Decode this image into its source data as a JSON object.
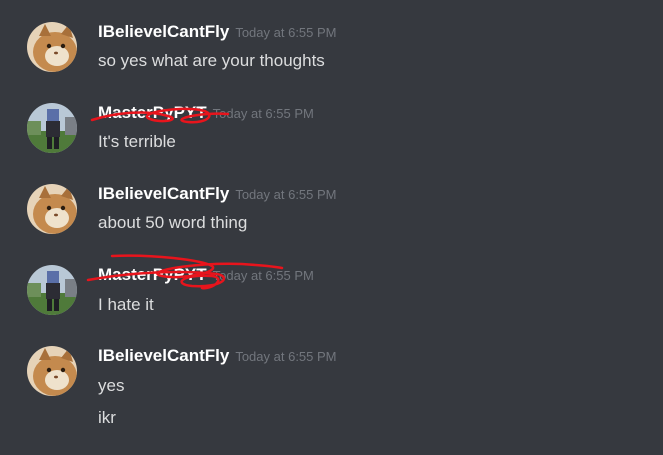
{
  "colors": {
    "background": "#36393f",
    "username": "#ffffff",
    "timestamp": "#72767d",
    "message_text": "#dcddde",
    "redaction_scribble": "#e8141c"
  },
  "messages": [
    {
      "username": "IBelievelCantFly",
      "timestamp": "Today at 6:55 PM",
      "avatar": "cat-avatar",
      "lines": [
        "so yes what are your thoughts"
      ]
    },
    {
      "username": "MasterPyPYT",
      "timestamp": "Today at 6:55 PM",
      "avatar": "minecraft-avatar",
      "lines": [
        "It's terrible"
      ]
    },
    {
      "username": "IBelievelCantFly",
      "timestamp": "Today at 6:55 PM",
      "avatar": "cat-avatar",
      "lines": [
        "about 50 word thing"
      ]
    },
    {
      "username": "MasterPyPYT",
      "timestamp": "Today at 6:55 PM",
      "avatar": "minecraft-avatar",
      "lines": [
        "I hate it"
      ]
    },
    {
      "username": "IBelievelCantFly",
      "timestamp": "Today at 6:55 PM",
      "avatar": "cat-avatar",
      "lines": [
        "yes",
        "ikr"
      ]
    }
  ]
}
